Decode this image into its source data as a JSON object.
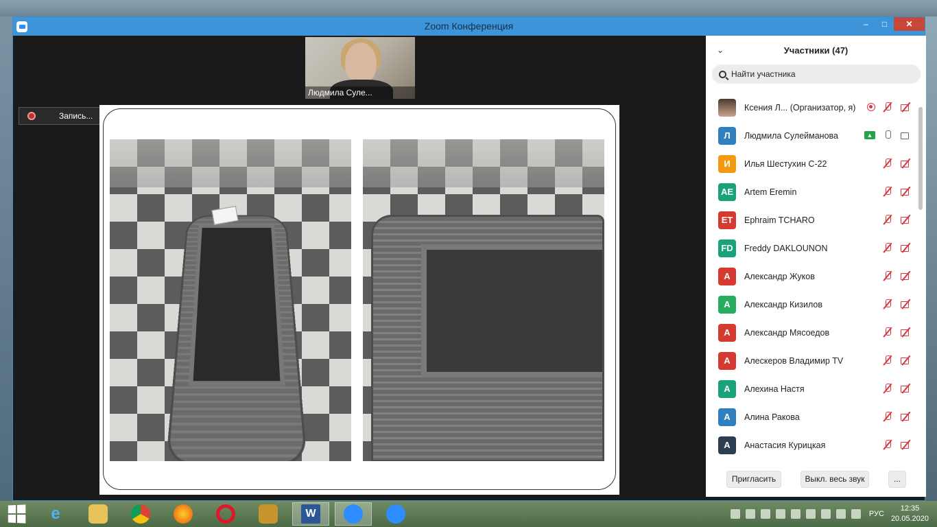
{
  "window": {
    "title": "Zoom Конференция",
    "controls": {
      "minimize": "–",
      "maximize": "□",
      "close": "✕"
    }
  },
  "video": {
    "name": "Людмила Суле..."
  },
  "recording": {
    "label": "Запись..."
  },
  "participants": {
    "title": "Участники (47)",
    "search_placeholder": "Найти участника",
    "items": [
      {
        "initials": "",
        "name": "Ксения Л...   (Организатор, я)",
        "color": "#6b4a3a",
        "photo": true
      },
      {
        "initials": "Л",
        "name": "Людмила Сулейманова",
        "color": "#2f7fc1"
      },
      {
        "initials": "И",
        "name": "Илья Шестухин С-22",
        "color": "#f39a12"
      },
      {
        "initials": "AE",
        "name": "Artem Eremin",
        "color": "#1aa37a"
      },
      {
        "initials": "ET",
        "name": "Ephraim TCHARO",
        "color": "#d43a2f"
      },
      {
        "initials": "FD",
        "name": "Freddy DAKLOUNON",
        "color": "#1aa37a"
      },
      {
        "initials": "А",
        "name": "Александр Жуков",
        "color": "#d43a2f"
      },
      {
        "initials": "А",
        "name": "Александр Кизилов",
        "color": "#27ad60"
      },
      {
        "initials": "А",
        "name": "Александр Мясоедов",
        "color": "#d43a2f"
      },
      {
        "initials": "А",
        "name": "Алескеров Владимир TV",
        "color": "#d43a2f"
      },
      {
        "initials": "А",
        "name": "Алехина Настя",
        "color": "#1aa37a"
      },
      {
        "initials": "А",
        "name": "Алина Ракова",
        "color": "#2f7fc1"
      },
      {
        "initials": "А",
        "name": "Анастасия Курицкая",
        "color": "#2c3e50"
      }
    ],
    "invite_label": "Пригласить",
    "mute_all_label": "Выкл. весь звук",
    "more_label": "..."
  },
  "taskbar": {
    "language": "РУС",
    "time": "12:35",
    "date": "20.05.2020"
  }
}
